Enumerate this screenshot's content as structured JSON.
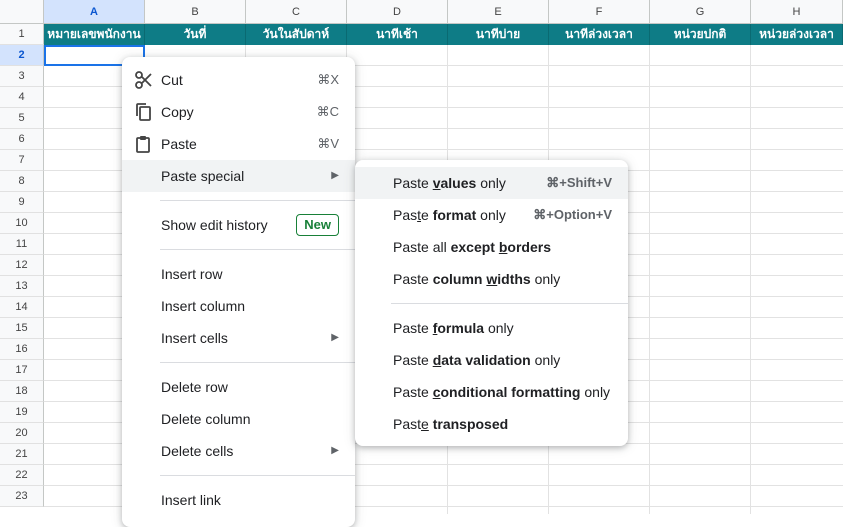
{
  "sheet": {
    "columns": [
      "A",
      "B",
      "C",
      "D",
      "E",
      "F",
      "G",
      "H"
    ],
    "rows": [
      "1",
      "2",
      "3",
      "4",
      "5",
      "6",
      "7",
      "8",
      "9",
      "10",
      "11",
      "12",
      "13",
      "14",
      "15",
      "16",
      "17",
      "18",
      "19",
      "20",
      "21",
      "22",
      "23"
    ],
    "active_column": "A",
    "active_row": "2",
    "header_row": [
      "หมายเลขพนักงาน",
      "วันที่",
      "วันในสัปดาห์",
      "นาทีเช้า",
      "นาทีบ่าย",
      "นาทีล่วงเวลา",
      "หน่วยปกติ",
      "หน่วยล่วงเวลา"
    ],
    "header_color": "#0e7c86",
    "selection_color": "#1a73e8"
  },
  "context_menu": {
    "cut": {
      "label": "Cut",
      "shortcut": "⌘X",
      "icon": "scissors-icon"
    },
    "copy": {
      "label": "Copy",
      "shortcut": "⌘C",
      "icon": "copy-icon"
    },
    "paste": {
      "label": "Paste",
      "shortcut": "⌘V",
      "icon": "clipboard-icon"
    },
    "paste_special": {
      "label": "Paste special",
      "arrow": "▶"
    },
    "show_edit_history": {
      "label": "Show edit history",
      "badge": "New"
    },
    "insert_row": {
      "label": "Insert row"
    },
    "insert_column": {
      "label": "Insert column"
    },
    "insert_cells": {
      "label": "Insert cells",
      "arrow": "▶"
    },
    "delete_row": {
      "label": "Delete row"
    },
    "delete_column": {
      "label": "Delete column"
    },
    "delete_cells": {
      "label": "Delete cells",
      "arrow": "▶"
    },
    "insert_link": {
      "label": "Insert link"
    }
  },
  "submenu": {
    "values_only": {
      "pre": "Paste ",
      "u": "v",
      "bold_rest": "alues",
      "post": " only",
      "shortcut": "⌘+Shift+V"
    },
    "format_only": {
      "pre": "Pas",
      "u": "t",
      "mid": "e ",
      "bold": "format",
      "post": " only",
      "shortcut": "⌘+Option+V"
    },
    "all_except_borders": {
      "pre": "Paste all ",
      "bold": "except ",
      "u": "b",
      "bold_rest": "orders"
    },
    "column_widths_only": {
      "pre": "Paste ",
      "bold": "column ",
      "u": "w",
      "bold_rest": "idths",
      "post": " only"
    },
    "formula_only": {
      "pre": "Paste ",
      "u": "f",
      "bold_rest": "ormula",
      "post": " only"
    },
    "data_validation_only": {
      "pre": "Paste ",
      "u": "d",
      "bold_rest": "ata validation",
      "post": " only"
    },
    "conditional_formatting_only": {
      "pre": "Paste ",
      "u": "c",
      "bold_rest": "onditional formatting",
      "post": " only"
    },
    "transposed": {
      "pre": "Past",
      "u": "e",
      "mid": " ",
      "bold": "transposed"
    }
  }
}
